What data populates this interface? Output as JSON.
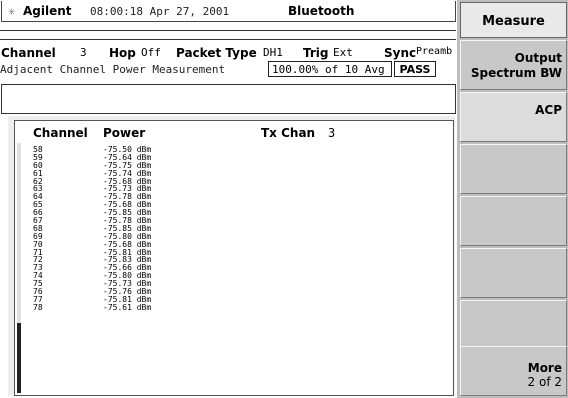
{
  "header": {
    "brand": "Agilent",
    "datetime": "08:00:18  Apr 27, 2001",
    "mode": "Bluetooth"
  },
  "params": {
    "channel_label": "Channel",
    "channel_value": "3",
    "hop_label": "Hop",
    "hop_value": "Off",
    "packet_label": "Packet Type",
    "packet_value": "DH1",
    "trig_label": "Trig",
    "trig_value": "Ext",
    "sync_label": "Sync",
    "sync_value": "Preamb"
  },
  "measurement": {
    "name": "Adjacent Channel Power Measurement",
    "averaging": "100.00% of 10 Avg",
    "status": "PASS"
  },
  "table": {
    "col_channel": "Channel",
    "col_power": "Power",
    "tx_label": "Tx Chan",
    "tx_value": "3",
    "rows": [
      {
        "ch": "58",
        "power": "-75.50 dBm"
      },
      {
        "ch": "59",
        "power": "-75.64 dBm"
      },
      {
        "ch": "60",
        "power": "-75.75 dBm"
      },
      {
        "ch": "61",
        "power": "-75.74 dBm"
      },
      {
        "ch": "62",
        "power": "-75.68 dBm"
      },
      {
        "ch": "63",
        "power": "-75.73 dBm"
      },
      {
        "ch": "64",
        "power": "-75.78 dBm"
      },
      {
        "ch": "65",
        "power": "-75.68 dBm"
      },
      {
        "ch": "66",
        "power": "-75.85 dBm"
      },
      {
        "ch": "67",
        "power": "-75.78 dBm"
      },
      {
        "ch": "68",
        "power": "-75.85 dBm"
      },
      {
        "ch": "69",
        "power": "-75.80 dBm"
      },
      {
        "ch": "70",
        "power": "-75.68 dBm"
      },
      {
        "ch": "71",
        "power": "-75.81 dBm"
      },
      {
        "ch": "72",
        "power": "-75.83 dBm"
      },
      {
        "ch": "73",
        "power": "-75.66 dBm"
      },
      {
        "ch": "74",
        "power": "-75.80 dBm"
      },
      {
        "ch": "75",
        "power": "-75.73 dBm"
      },
      {
        "ch": "76",
        "power": "-75.76 dBm"
      },
      {
        "ch": "77",
        "power": "-75.81 dBm"
      },
      {
        "ch": "78",
        "power": "-75.61 dBm"
      }
    ]
  },
  "softkeys": {
    "menu_title": "Measure",
    "key1_l1": "Output",
    "key1_l2": "Spectrum BW",
    "key2_l1": "ACP",
    "more_l1": "More",
    "more_l2": "2 of 2"
  },
  "icons": {
    "logo": "agilent-spark-icon"
  }
}
